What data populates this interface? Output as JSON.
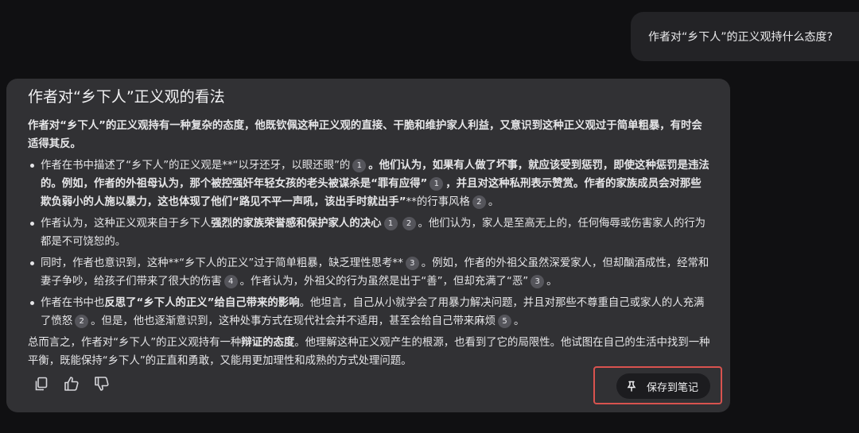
{
  "conversation": {
    "user_question": "作者对“乡下人”的正义观持什么态度?"
  },
  "answer": {
    "title": "作者对“乡下人”正义观的看法",
    "intro": "作者对“乡下人”的正义观持有一种复杂的态度，他既钦佩这种正义观的直接、干脆和维护家人利益，又意识到这种正义观过于简单粗暴，有时会适得其反。",
    "points": [
      {
        "parts": [
          {
            "t": "作者在书中描述了“乡下人”的正义观是**“以牙还牙，以眼还眼”的",
            "b": false
          },
          {
            "cite": "1"
          },
          {
            "t": "。他们认为，如果有人做了坏事，就应该受到惩罚，即使这种惩罚是违法的。例如，作者的外祖母认为，那个被控强奸年轻女孩的老头被谋杀是“罪有应得”",
            "b": true
          },
          {
            "cite": "1"
          },
          {
            "t": "，并且对这种私刑表示赞赏。作者的家族成员会对那些欺负弱小的人施以暴力，这也体现了他们“路见不平一声吼，该出手时就出手”",
            "b": true
          },
          {
            "t": "**的行事风格",
            "b": false
          },
          {
            "cite": "2"
          },
          {
            "t": "。",
            "b": false
          }
        ]
      },
      {
        "parts": [
          {
            "t": "作者认为，这种正义观来自于乡下人",
            "b": false
          },
          {
            "t": "强烈的家族荣誉感和保护家人的决心",
            "b": true
          },
          {
            "cite": "1"
          },
          {
            "cite": "2"
          },
          {
            "t": "。他们认为，家人是至高无上的，任何侮辱或伤害家人的行为都是不可饶恕的。",
            "b": false
          }
        ]
      },
      {
        "parts": [
          {
            "t": "同时，作者也意识到，这种**“乡下人的正义”过于简单粗暴，缺乏理性思考**",
            "b": false
          },
          {
            "cite": "3"
          },
          {
            "t": "。例如，作者的外祖父虽然深爱家人，但却酗酒成性，经常和妻子争吵，给孩子们带来了很大的伤害",
            "b": false
          },
          {
            "cite": "4"
          },
          {
            "t": "。作者认为，外祖父的行为虽然是出于“善”，但却充满了“恶”",
            "b": false
          },
          {
            "cite": "3"
          },
          {
            "t": "。",
            "b": false
          }
        ]
      },
      {
        "parts": [
          {
            "t": "作者在书中也",
            "b": false
          },
          {
            "t": "反思了“乡下人的正义”给自己带来的影响",
            "b": true
          },
          {
            "t": "。他坦言，自己从小就学会了用暴力解决问题，并且对那些不尊重自己或家人的人充满了愤怒",
            "b": false
          },
          {
            "cite": "2"
          },
          {
            "t": "。但是，他也逐渐意识到，这种处事方式在现代社会并不适用，甚至会给自己带来麻烦",
            "b": false
          },
          {
            "cite": "5"
          },
          {
            "t": "。",
            "b": false
          }
        ]
      }
    ],
    "conclusion": [
      {
        "t": "总而言之，作者对“乡下人”的正义观持有一种",
        "b": false
      },
      {
        "t": "辩证的态度",
        "b": true
      },
      {
        "t": "。他理解这种正义观产生的根源，也看到了它的局限性。他试图在自己的生活中找到一种平衡，既能保持“乡下人”的正直和勇敢，又能用更加理性和成熟的方式处理问题。",
        "b": false
      }
    ]
  },
  "actions": {
    "copy_icon": "copy-icon",
    "like_icon": "thumbs-up-icon",
    "dislike_icon": "thumbs-down-icon",
    "save_label": "保存到笔记",
    "highlight_color": "#d9534f"
  }
}
